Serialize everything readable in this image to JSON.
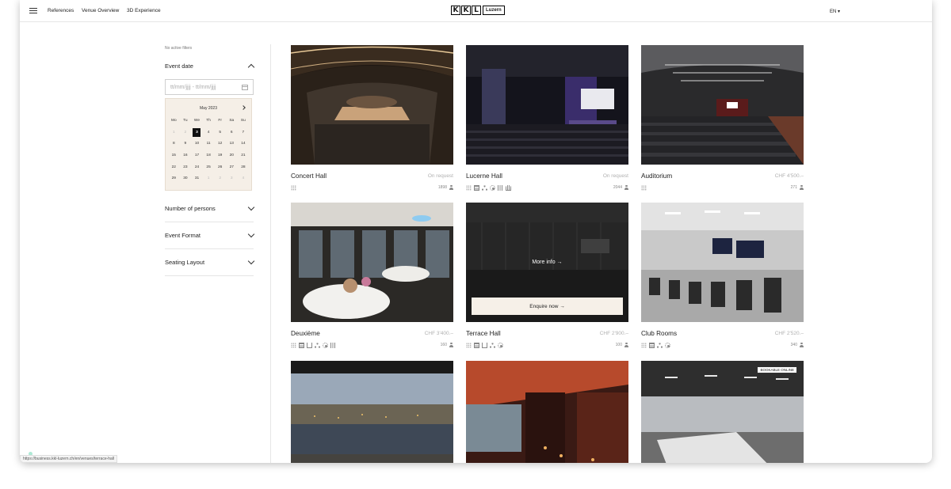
{
  "nav": {
    "links": [
      "References",
      "Venue Overview",
      "3D Experience"
    ],
    "logo_letters": [
      "K",
      "K",
      "L"
    ],
    "logo_word": "Luzern",
    "language": "EN"
  },
  "filters": {
    "no_active": "No active filters",
    "event_date": {
      "label": "Event date",
      "placeholder": "tt/mm/jjjj - tt/mm/jjjj",
      "calendar": {
        "month": "May 2023",
        "weekdays": [
          "Mo",
          "Tu",
          "We",
          "Th",
          "Fr",
          "Sa",
          "Su"
        ],
        "days": [
          "1",
          "2",
          "3",
          "4",
          "5",
          "6",
          "7",
          "8",
          "9",
          "10",
          "11",
          "12",
          "13",
          "14",
          "15",
          "16",
          "17",
          "18",
          "19",
          "20",
          "21",
          "22",
          "23",
          "24",
          "25",
          "26",
          "27",
          "28",
          "29",
          "30",
          "31",
          "1",
          "2",
          "3",
          "4"
        ],
        "selected": "3"
      }
    },
    "groups": [
      "Number of persons",
      "Event Format",
      "Seating Layout"
    ]
  },
  "venues": [
    {
      "name": "Concert Hall",
      "price": "On request",
      "capacity": "1898",
      "icons": [
        "grid-icon"
      ]
    },
    {
      "name": "Lucerne Hall",
      "price": "On request",
      "capacity": "2044",
      "icons": [
        "grid-icon",
        "rows-icon",
        "dots-icon",
        "sun-icon",
        "bars-icon",
        "theater-icon"
      ]
    },
    {
      "name": "Auditorium",
      "price": "CHF 4'500.–",
      "capacity": "271",
      "icons": [
        "grid-icon"
      ]
    },
    {
      "name": "Deuxième",
      "price": "CHF 3'400.–",
      "capacity": "160",
      "icons": [
        "grid-icon",
        "rows-icon",
        "ushape-icon",
        "dots-icon",
        "sun-icon",
        "bars-icon"
      ]
    },
    {
      "name": "Terrace Hall",
      "price": "CHF 2'900.–",
      "capacity": "100",
      "icons": [
        "grid-icon",
        "rows-icon",
        "ushape-icon",
        "dots-icon",
        "sun-icon"
      ],
      "more_info": "More info",
      "enquire": "Enquire now"
    },
    {
      "name": "Club Rooms",
      "price": "CHF 2'520.–",
      "capacity": "340",
      "icons": [
        "grid-icon",
        "rows-icon",
        "dots-icon",
        "sun-icon"
      ]
    },
    {
      "name": "",
      "price": "",
      "capacity": "",
      "icons": []
    },
    {
      "name": "",
      "price": "",
      "capacity": "",
      "icons": []
    },
    {
      "name": "",
      "price": "",
      "capacity": "",
      "icons": [],
      "badge": "BOOKABLE ONLINE"
    }
  ],
  "status_url": "https://business.kkl-luzern.ch/en/venues/terrace-hall"
}
